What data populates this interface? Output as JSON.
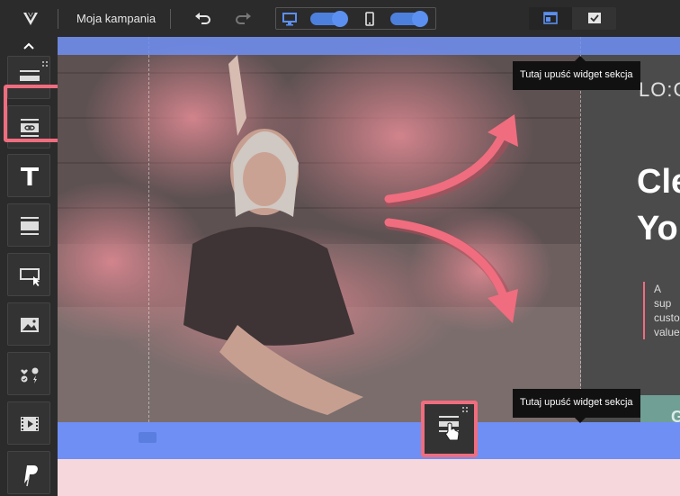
{
  "app": {
    "campaign_name": "Moja kampania",
    "icons": [
      "logo-icon",
      "undo-icon",
      "redo-icon",
      "desktop-icon",
      "mobile-icon",
      "layout-icon",
      "check-icon",
      "chevron-up-icon"
    ],
    "accent_color": "#5b8ff0",
    "highlight_color": "#ef6d7e"
  },
  "sidebar": {
    "tools": [
      {
        "name": "section-widget"
      },
      {
        "name": "button-link-widget"
      },
      {
        "name": "text-widget"
      },
      {
        "name": "layout-widget"
      },
      {
        "name": "click-area-widget"
      },
      {
        "name": "image-widget"
      },
      {
        "name": "icons-widget"
      },
      {
        "name": "video-widget"
      },
      {
        "name": "paypal-widget"
      }
    ]
  },
  "canvas": {
    "logo_text": "LO:C",
    "headline_1": "Cle",
    "headline_2": "Yo",
    "body_text_1": "A sup",
    "body_text_2": "custo",
    "body_text_3": "value",
    "cta_label": "G"
  },
  "tooltips": {
    "top": "Tutaj upuść widget sekcja",
    "bottom": "Tutaj upuść widget sekcja"
  }
}
